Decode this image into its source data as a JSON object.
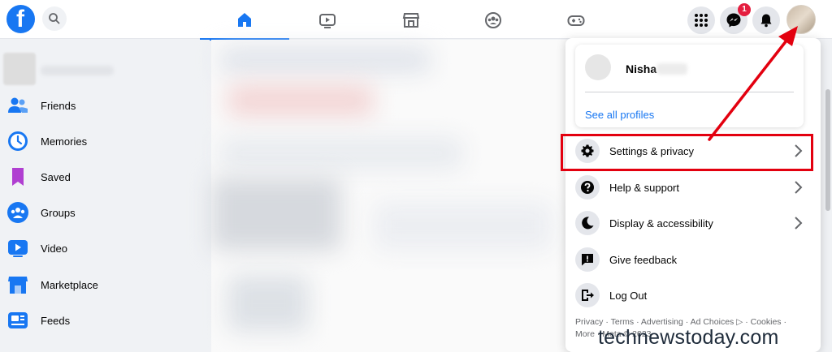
{
  "topbar": {
    "logo_letter": "f",
    "nav_tabs": [
      {
        "name": "home",
        "active": true
      },
      {
        "name": "watch",
        "active": false
      },
      {
        "name": "marketplace",
        "active": false
      },
      {
        "name": "groups",
        "active": false
      },
      {
        "name": "gaming",
        "active": false
      }
    ],
    "messenger_badge": "1"
  },
  "sidebar": {
    "items": [
      {
        "label": "Friends",
        "icon": "friends-icon"
      },
      {
        "label": "Memories",
        "icon": "memories-icon"
      },
      {
        "label": "Saved",
        "icon": "saved-icon"
      },
      {
        "label": "Groups",
        "icon": "groups-icon"
      },
      {
        "label": "Video",
        "icon": "video-icon"
      },
      {
        "label": "Marketplace",
        "icon": "marketplace-icon"
      },
      {
        "label": "Feeds",
        "icon": "feeds-icon"
      }
    ]
  },
  "menu": {
    "profile_name": "Nisha",
    "see_all_profiles": "See all profiles",
    "items": [
      {
        "label": "Settings & privacy",
        "icon": "gear-icon",
        "has_chevron": true
      },
      {
        "label": "Help & support",
        "icon": "question-icon",
        "has_chevron": true
      },
      {
        "label": "Display & accessibility",
        "icon": "moon-icon",
        "has_chevron": true
      },
      {
        "label": "Give feedback",
        "icon": "feedback-icon",
        "has_chevron": false
      },
      {
        "label": "Log Out",
        "icon": "logout-icon",
        "has_chevron": false
      }
    ],
    "footer_line1": "Privacy · Terms · Advertising · Ad Choices ▷ · Cookies ·",
    "footer_line2": "More · Meta © 2023"
  },
  "watermark": "technewstoday.com",
  "colors": {
    "brand": "#1877f2",
    "highlight": "#e3000f",
    "badge": "#e41e3f"
  }
}
